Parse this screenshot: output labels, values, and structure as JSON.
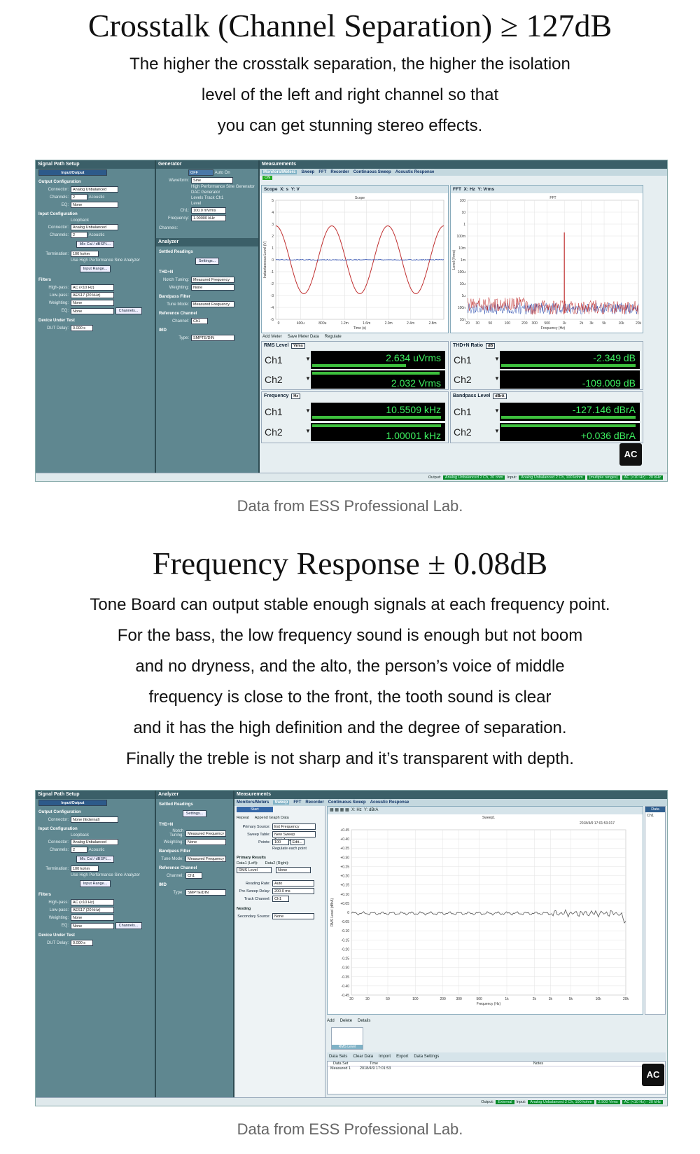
{
  "section1": {
    "title": "Crosstalk (Channel Separation) ≥ 127dB",
    "lines": [
      "The higher the crosstalk separation, the higher the isolation",
      "level of the left and right channel so that",
      "you can get stunning stereo effects."
    ],
    "caption": "Data from ESS Professional Lab."
  },
  "section2": {
    "title": "Frequency Response ± 0.08dB",
    "lines": [
      "Tone Board can output stable enough signals at each frequency point.",
      "For the bass, the low frequency sound is enough but not boom",
      "and no dryness, and the alto, the person’s voice of middle",
      "frequency is close to the front, the tooth sound is clear",
      "and it has the high definition and the degree of separation.",
      "Finally the treble is not sharp and it’s transparent with depth."
    ],
    "caption": "Data from ESS Professional Lab."
  },
  "app": {
    "signal_path": {
      "header": "Signal Path Setup",
      "dropdown": "Input/Output",
      "output_config": "Output Configuration",
      "connector_label": "Connector:",
      "connector_value_1": "Analog Unbalanced",
      "connector_value_2": "None (External)",
      "channels_label": "Channels:",
      "channels_value": "2",
      "acoustic": "Acoustic",
      "eq_label": "EQ:",
      "none": "None",
      "input_config": "Input Configuration",
      "loopback": "Loopback",
      "mic_cal": "Mic Cal / dBSPL...",
      "termination_label": "Termination:",
      "termination_value": "100 kohm",
      "high_perf": "Use High Performance Sine Analyzer",
      "input_range": "Input Range...",
      "filters": "Filters",
      "highpass_label": "High-pass:",
      "highpass_value": "AC (<10 Hz)",
      "lowpass_label": "Low-pass:",
      "lowpass_value": "AES17 (20 kHz)",
      "weighting_label": "Weighting:",
      "channels_btn": "Channels...",
      "dut": "Device Under Test",
      "dut_delay_label": "DUT Delay:",
      "dut_delay_value": "0.000 s"
    },
    "generator": {
      "header": "Generator",
      "off": "OFF",
      "auto_on": "Auto On",
      "waveform_label": "Waveform:",
      "waveform_value": "Sine",
      "hp_sine": "High Performance Sine Generator",
      "dac_gen": "DAC Generator",
      "levels_track": "Levels Track Ch1",
      "level": "Level",
      "ch1_label": "Ch1:",
      "ch1_value": "100.0 mVrms",
      "freq_label": "Frequency:",
      "freq_value": "1.00000 kHz",
      "channels": "Channels:"
    },
    "analyzer": {
      "header": "Analyzer",
      "settled": "Settled Readings",
      "settings": "Settings...",
      "thdn": "THD+N",
      "notch_label": "Notch Tuning:",
      "notch_value": "Measured Frequency",
      "weighting_label": "Weighting:",
      "weighting_value": "None",
      "bandpass": "Bandpass Filter",
      "tune_label": "Tune Mode:",
      "tune_value": "Measured Frequency",
      "ref_channel": "Reference Channel",
      "channel_label": "Channel:",
      "channel_value": "Ch1",
      "imd": "IMD",
      "type_label": "Type:",
      "type_value": "SMPTE/DIN"
    },
    "measurements": {
      "header": "Measurements",
      "tabs": [
        "Monitors/Meters",
        "Sweep",
        "FFT",
        "Recorder",
        "Continuous Sweep",
        "Acoustic Response"
      ],
      "on": "ON",
      "scope_title": "Scope",
      "scope_x": "X: s",
      "scope_y": "Y: V",
      "scope_caption": "Scope",
      "scope_ylabel": "Instantaneous Level (V)",
      "scope_xlabel": "Time (s)",
      "scope_yticks": [
        "5",
        "4",
        "3",
        "2",
        "1",
        "0",
        "-1",
        "-2",
        "-3",
        "-4",
        "-5"
      ],
      "scope_xticks": [
        "0",
        "400u",
        "800u",
        "1.2m",
        "1.6m",
        "2.0m",
        "2.4m",
        "2.8m"
      ],
      "fft_title": "FFT",
      "fft_x": "X: Hz",
      "fft_y": "Y: Vrms",
      "fft_caption": "FFT",
      "fft_ylabel": "Level (Vrms)",
      "fft_xlabel": "Frequency (Hz)",
      "fft_yticks": [
        "100",
        "10",
        "1",
        "100m",
        "10m",
        "1m",
        "100u",
        "10u",
        "1u",
        "100n",
        "10n"
      ],
      "fft_xticks": [
        "20",
        "30",
        "50",
        "100",
        "200",
        "300",
        "500",
        "1k",
        "2k",
        "3k",
        "5k",
        "10k",
        "20k"
      ],
      "add_meter": "Add Meter",
      "save_meter": "Save Meter Data",
      "regulate": "Regulate",
      "rms_level": "RMS Level",
      "rms_unit": "Vrms",
      "thdn_ratio": "THD+N Ratio",
      "thdn_unit": "dB",
      "frequency": "Frequency",
      "freq_unit": "Hz",
      "bandpass_level": "Bandpass Level",
      "bandpass_unit": "dBrA",
      "ch1": "Ch1",
      "ch2": "Ch2",
      "rms_ch1": "2.634   uVrms",
      "rms_ch2": "2.032     Vrms",
      "thdn_ch1": "-2.349   dB",
      "thdn_ch2": "-109.009   dB",
      "freq_ch1": "10.5509   kHz",
      "freq_ch2": "1.00001   kHz",
      "bp_ch1": "-127.146   dBrA",
      "bp_ch2": "+0.036   dBrA"
    },
    "status1": {
      "output_label": "Output:",
      "output_value": "Analog Unbalanced 2 Ch, 20 ohm",
      "input_label": "Input:",
      "input_value": "Analog Unbalanced 2 Ch, 100 kohm",
      "range": "(multiple ranges)",
      "filter": "AC (<10 Hz) - 20 kHz"
    },
    "status2": {
      "output_label": "Output:",
      "output_value": "External",
      "input_label": "Input:",
      "input_value": "Analog Unbalanced 2 Ch, 100 kohm",
      "range": "2.500 Vrms",
      "filter": "AC (<10 Hz) - 20 kHz"
    },
    "sweep": {
      "start": "Start",
      "repeat": "Repeat",
      "append": "Append Graph Data",
      "primary_source_label": "Primary Source:",
      "primary_source_value": "Ext Frequency",
      "sweep_table_label": "Sweep Table:",
      "sweep_table_value": "New Sweep Table1.csv",
      "points_label": "Points:",
      "points_value": "100",
      "edit": "Edit...",
      "regulate_each": "Regulate each point",
      "primary_results": "Primary Results",
      "data1": "Data1 (Left):",
      "data2": "Data2 (Right):",
      "rms_level": "RMS Level",
      "none": "None",
      "reading_rate_label": "Reading Rate:",
      "reading_rate_value": "Auto",
      "pre_sweep_label": "Pre-Sweep Delay:",
      "pre_sweep_value": "200.0 ms",
      "track_label": "Track Channel:",
      "track_value": "Ch1",
      "nesting": "Nesting",
      "secondary_label": "Secondary Source:",
      "secondary_value": "None",
      "graph_x": "X: Hz",
      "graph_y": "Y: dBrA",
      "legend_top": "Sweep1",
      "timestamp": "2018/4/9 17:01:53.017",
      "ylabel": "RMS Level (dBrA)",
      "xlabel": "Frequency (Hz)",
      "yticks": [
        "+0.45",
        "+0.40",
        "+0.35",
        "+0.30",
        "+0.25",
        "+0.20",
        "+0.15",
        "+0.10",
        "+0.05",
        "0",
        "-0.05",
        "-0.10",
        "-0.15",
        "-0.20",
        "-0.25",
        "-0.30",
        "-0.35",
        "-0.40",
        "-0.45"
      ],
      "xticks": [
        "20",
        "30",
        "50",
        "100",
        "200",
        "300",
        "500",
        "1k",
        "2k",
        "3k",
        "5k",
        "10k",
        "20k"
      ],
      "data_header": "Data",
      "data_ch1": "Ch1",
      "add": "Add",
      "delete": "Delete",
      "details": "Details",
      "thumb_label": "RMS Level",
      "data_sets": "Data Sets",
      "clear_data": "Clear Data",
      "import": "Import",
      "export": "Export",
      "data_settings": "Data Settings",
      "col_data_set": "Data Set",
      "col_time": "Time",
      "col_notes": "Notes",
      "row_name": "Measured 1",
      "row_time": "2018/4/9 17:01:53"
    },
    "logo_text": "AC"
  }
}
